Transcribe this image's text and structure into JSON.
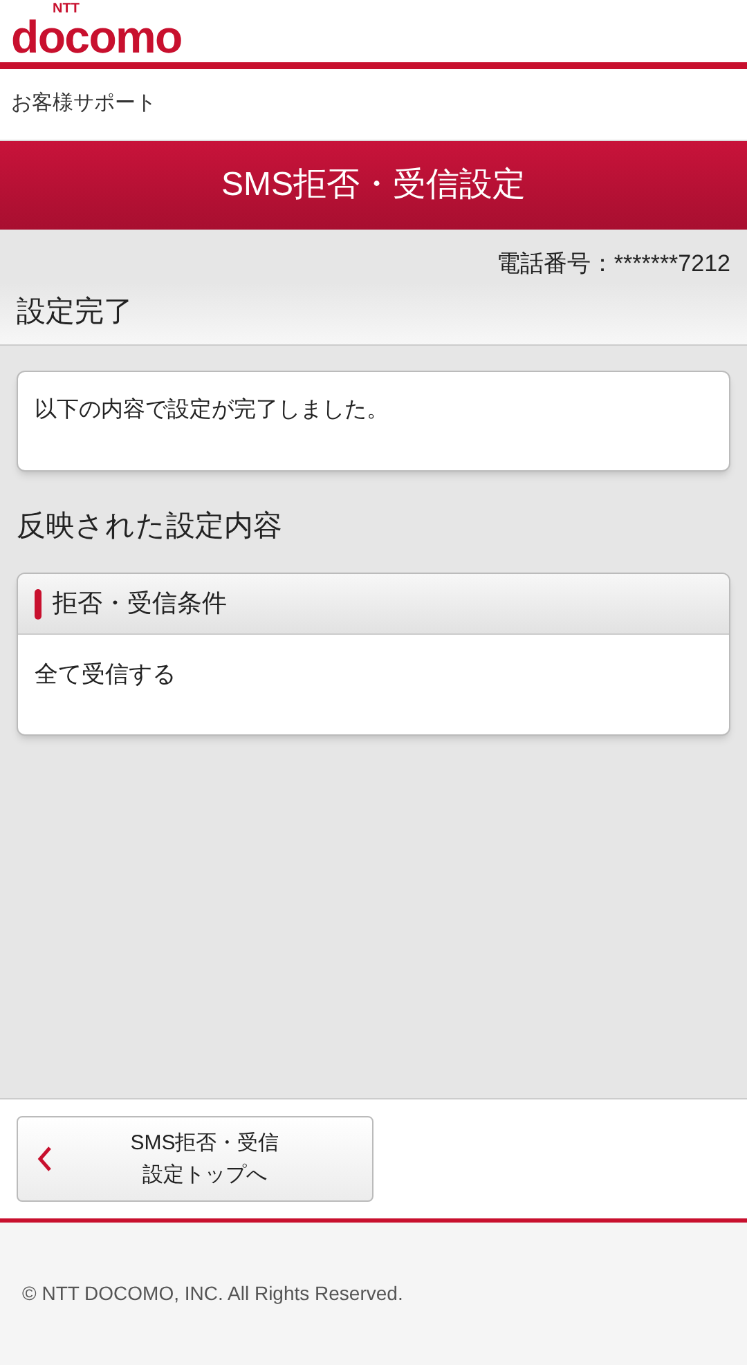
{
  "logo": {
    "top": "NTT",
    "main": "docomo"
  },
  "breadcrumb": "お客様サポート",
  "page_title": "SMS拒否・受信設定",
  "phone_number": "電話番号：*******7212",
  "section_title": "設定完了",
  "message": "以下の内容で設定が完了しました。",
  "applied_heading": "反映された設定内容",
  "settings_card": {
    "title": "拒否・受信条件",
    "value": "全て受信する"
  },
  "back_button": {
    "lines": [
      "SMS拒否・受信",
      "設定トップへ"
    ]
  },
  "footer": "© NTT DOCOMO, INC. All Rights Reserved."
}
